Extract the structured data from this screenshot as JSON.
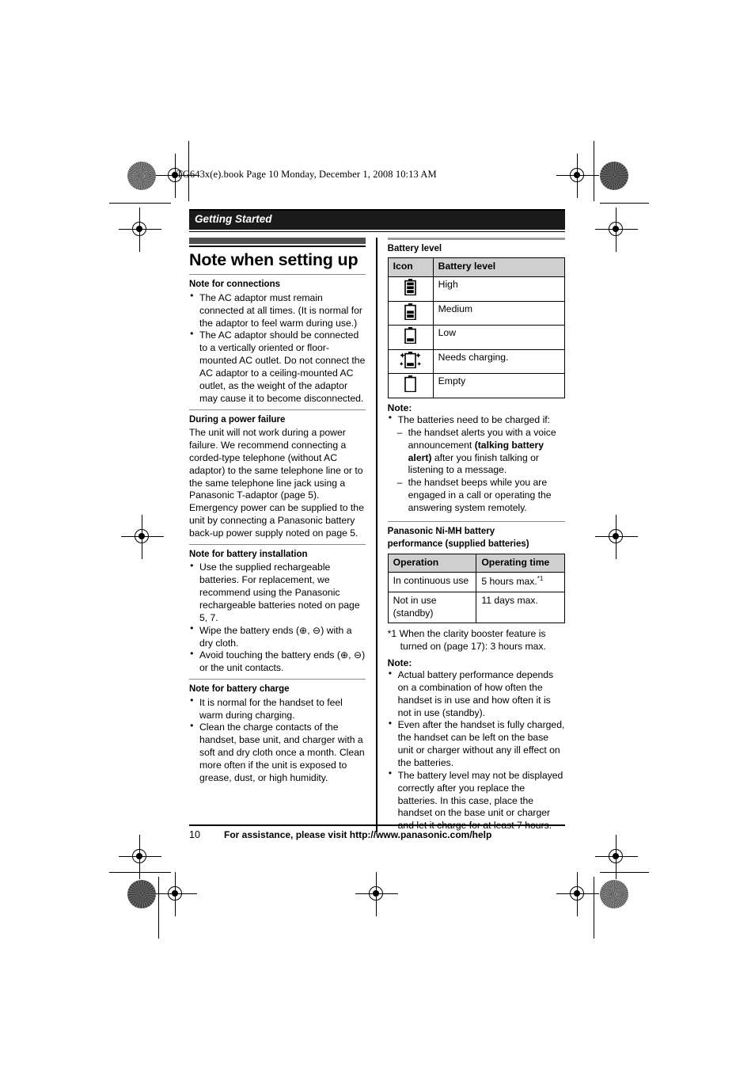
{
  "running_head": "TG643x(e).book  Page 10  Monday, December 1, 2008  10:13 AM",
  "section_bar": {
    "title": "Getting Started"
  },
  "left_column": {
    "chapter_title": "Note when setting up",
    "blocks": [
      {
        "heading": "Note for connections",
        "bullets": [
          "The AC adaptor must remain connected at all times. (It is normal for the adaptor to feel warm during use.)",
          "The AC adaptor should be connected to a vertically oriented or floor-mounted AC outlet. Do not connect the AC adaptor to a ceiling-mounted AC outlet, as the weight of the adaptor may cause it to become disconnected."
        ]
      },
      {
        "heading": "During a power failure",
        "paragraph": "The unit will not work during a power failure. We recommend connecting a corded-type telephone (without AC adaptor) to the same telephone line or to the same telephone line jack using a Panasonic T-adaptor (page 5). Emergency power can be supplied to the unit by connecting a Panasonic battery back-up power supply noted on page 5."
      },
      {
        "heading": "Note for battery installation",
        "bullets": [
          "Use the supplied rechargeable batteries. For replacement, we recommend using the Panasonic rechargeable batteries noted on page 5, 7.",
          "Wipe the battery ends (⊕, ⊖) with a dry cloth.",
          "Avoid touching the battery ends (⊕, ⊖) or the unit contacts."
        ]
      },
      {
        "heading": "Note for battery charge",
        "bullets": [
          "It is normal for the handset to feel warm during charging.",
          "Clean the charge contacts of the handset, base unit, and charger with a soft and dry cloth once a month. Clean more often if the unit is exposed to grease, dust, or high humidity."
        ]
      }
    ]
  },
  "right_column": {
    "battery_level_heading": "Battery level",
    "battery_table": {
      "headers": [
        "Icon",
        "Battery level"
      ],
      "rows": [
        {
          "icon": "battery-full-icon",
          "level": "High"
        },
        {
          "icon": "battery-medium-icon",
          "level": "Medium"
        },
        {
          "icon": "battery-low-icon",
          "level": "Low"
        },
        {
          "icon": "battery-flashing-icon",
          "level": "Needs charging."
        },
        {
          "icon": "battery-empty-icon",
          "level": "Empty"
        }
      ]
    },
    "note1": {
      "label": "Note:",
      "bullet": "The batteries need to be charged if:",
      "subitems": [
        {
          "pre": "the handset alerts you with a voice announcement ",
          "bold": "(talking battery alert)",
          "post": " after you finish talking or listening to a message."
        },
        {
          "pre": "the handset beeps while you are engaged in a call or operating the answering system remotely.",
          "bold": "",
          "post": ""
        }
      ]
    },
    "performance_heading_line1": "Panasonic Ni-MH battery",
    "performance_heading_line2": "performance (supplied batteries)",
    "performance_table": {
      "headers": [
        "Operation",
        "Operating time"
      ],
      "rows": [
        {
          "operation": "In continuous use",
          "time": "5 hours max.",
          "time_sup": "*1"
        },
        {
          "operation": "Not in use (standby)",
          "time": "11 days max.",
          "time_sup": ""
        }
      ]
    },
    "footnote_marker": "*1",
    "footnote_line1": "When the clarity booster feature is",
    "footnote_line2": "turned on (page 17): 3 hours max.",
    "note2": {
      "label": "Note:",
      "bullets": [
        "Actual battery performance depends on a combination of how often the handset is in use and how often it is not in use (standby).",
        "Even after the handset is fully charged, the handset can be left on the base unit or charger without any ill effect on the batteries.",
        "The battery level may not be displayed correctly after you replace the batteries. In this case, place the handset on the base unit or charger and let it charge for at least 7 hours."
      ]
    }
  },
  "footer": {
    "page_number": "10",
    "assistance": "For assistance, please visit http://www.panasonic.com/help"
  },
  "colors": {
    "section_bar_bg": "#1a1a1a",
    "section_bar_text": "#ffffff",
    "gray_bar": "#4f4f4f",
    "table_header_bg": "#cfcfcf",
    "rule": "#000000"
  }
}
